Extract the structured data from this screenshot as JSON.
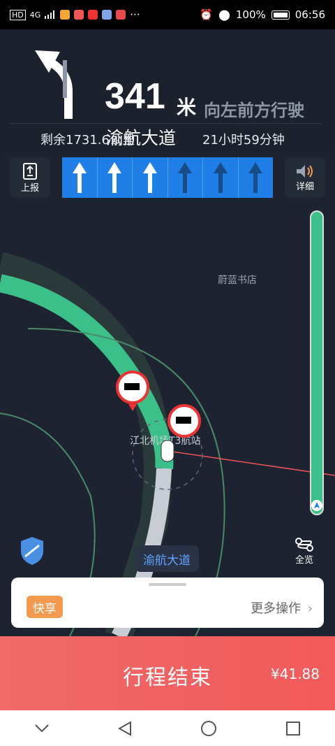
{
  "status_bar": {
    "network": "4G",
    "battery": "100%",
    "time": "06:56"
  },
  "nav": {
    "distance": "341",
    "unit": "米",
    "direction": "向左前方行驶",
    "road": "渝航大道",
    "remaining_distance": "剩余1731.6公里",
    "remaining_time": "21小时59分钟",
    "report_label": "上报",
    "detail_label": "详细",
    "lanes": [
      "active",
      "active",
      "active",
      "inactive",
      "inactive",
      "inactive"
    ]
  },
  "map": {
    "poi": "蔚蓝书店",
    "station": "江北机场T3航站",
    "road_label": "渝航大道",
    "overview_label": "全览"
  },
  "panel": {
    "share_tag": "快享",
    "more_ops": "更多操作"
  },
  "trip": {
    "end_label": "行程结束",
    "fare": "¥41.88"
  },
  "colors": {
    "lane_blue": "#1f7fe6",
    "route_green": "#3cc08a",
    "trip_red": "#f25a5a",
    "tag_orange": "#f39a4f"
  }
}
